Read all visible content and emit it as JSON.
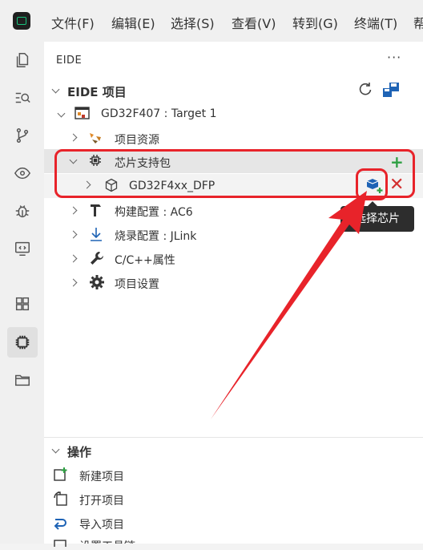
{
  "menu": {
    "items": [
      "文件(F)",
      "编辑(E)",
      "选择(S)",
      "查看(V)",
      "转到(G)",
      "终端(T)",
      "帮"
    ]
  },
  "sidebar": {
    "title": "EIDE",
    "more": "···",
    "project_section": "EIDE 项目",
    "project_name": "GD32F407 : Target 1",
    "tree": {
      "resources": "项目资源",
      "pack": "芯片支持包",
      "pack_item": "GD32F4xx_DFP",
      "build": "构建配置 : AC6",
      "flash": "烧录配置 : JLink",
      "cpp": "C/C++属性",
      "settings": "项目设置"
    },
    "tooltip": "选择芯片",
    "ops_section": "操作",
    "ops": {
      "new": "新建项目",
      "open": "打开项目",
      "import": "导入项目",
      "last": "设置工具链"
    }
  },
  "colors": {
    "annotation_red": "#e8232a",
    "accent_green": "#2ea043"
  }
}
